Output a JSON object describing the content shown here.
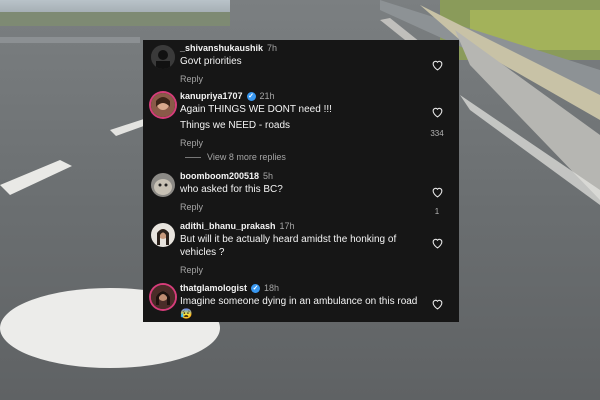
{
  "comments": [
    {
      "username": "_shivanshukaushik",
      "time": "7h",
      "verified": false,
      "lines": [
        "Govt priorities"
      ],
      "reply": "Reply",
      "likes": "",
      "more": ""
    },
    {
      "username": "kanupriya1707",
      "time": "21h",
      "verified": true,
      "lines": [
        "Again THINGS WE DONT need !!!",
        "Things we NEED - roads"
      ],
      "reply": "Reply",
      "likes": "334",
      "more": "View 8 more replies"
    },
    {
      "username": "boomboom200518",
      "time": "5h",
      "verified": false,
      "lines": [
        "who asked for this BC?"
      ],
      "reply": "Reply",
      "likes": "1",
      "more": ""
    },
    {
      "username": "adithi_bhanu_prakash",
      "time": "17h",
      "verified": false,
      "lines": [
        "But will it be actually heard amidst the honking of vehicles ?"
      ],
      "reply": "Reply",
      "likes": "",
      "more": ""
    },
    {
      "username": "thatglamologist",
      "time": "18h",
      "verified": true,
      "lines": [
        "Imagine someone dying in an ambulance on this road 😰"
      ],
      "reply": "",
      "likes": "",
      "more": ""
    }
  ],
  "icons": {
    "like": "heart-outline-icon",
    "verified": "verified-badge-icon"
  },
  "colors": {
    "panel": "#161616",
    "text": "#f4f4f4",
    "muted": "#a5a5a5",
    "verified": "#3897f0"
  }
}
